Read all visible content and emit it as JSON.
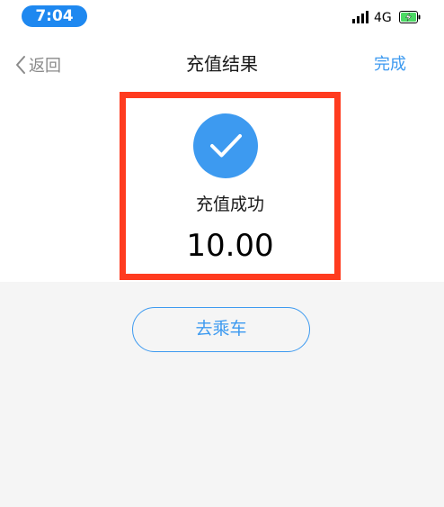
{
  "status_bar": {
    "time": "7:04",
    "network": "4G",
    "icons": [
      "signal-icon",
      "battery-charging-icon"
    ]
  },
  "nav": {
    "back_label": "返回",
    "title": "充值结果",
    "done_label": "完成"
  },
  "result": {
    "icon": "check-icon",
    "status": "充值成功",
    "amount": "10.00"
  },
  "actions": {
    "ride_label": "去乘车"
  },
  "colors": {
    "accent": "#3d9af0",
    "highlight_border": "#ff3b1f",
    "time_pill": "#1e88f0",
    "background": "#f5f5f5",
    "battery_fill": "#4cd964"
  }
}
